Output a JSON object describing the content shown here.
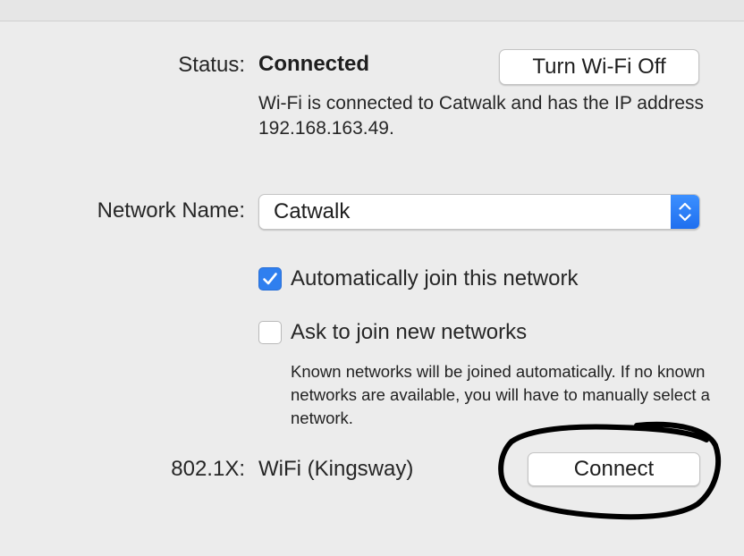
{
  "status": {
    "label": "Status:",
    "value": "Connected",
    "description": "Wi-Fi is connected to Catwalk and has the IP address 192.168.163.49.",
    "turn_off_label": "Turn Wi-Fi Off"
  },
  "network": {
    "label": "Network Name:",
    "selected": "Catwalk"
  },
  "options": {
    "auto_join": {
      "label": "Automatically join this network",
      "checked": true
    },
    "ask_join": {
      "label": "Ask to join new networks",
      "checked": false
    },
    "ask_join_note": "Known networks will be joined automatically. If no known networks are available, you will have to manually select a network."
  },
  "dot1x": {
    "label": "802.1X:",
    "value": "WiFi (Kingsway)",
    "connect_label": "Connect"
  },
  "colors": {
    "accent": "#2f7fef",
    "window_background": "#ececec",
    "annotation_ink": "#000000"
  },
  "icons": {
    "checkbox_checked": "checkmark-icon",
    "select_stepper": "chevron-up-down-icon"
  }
}
